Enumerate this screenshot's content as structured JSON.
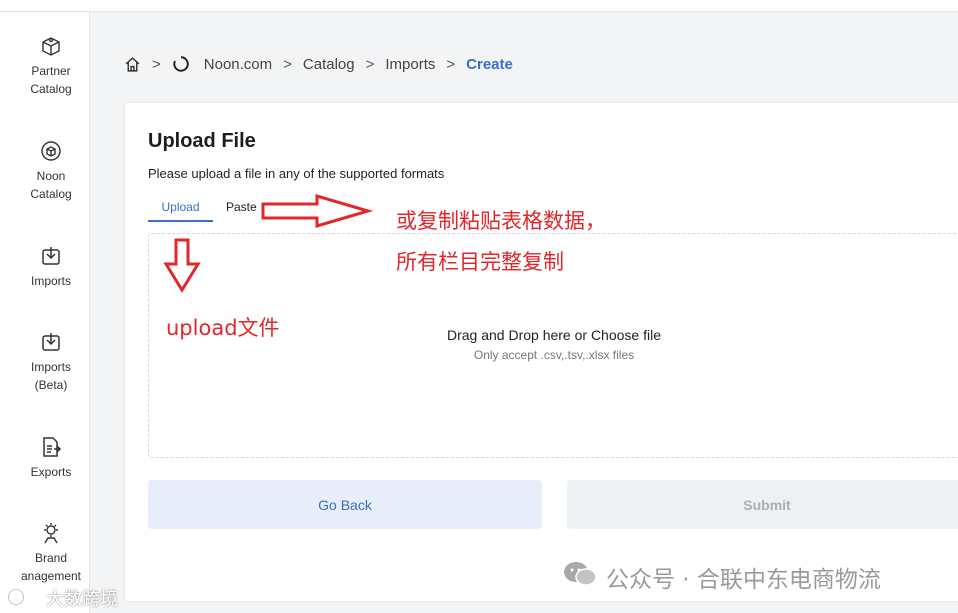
{
  "sidebar": {
    "items": [
      {
        "label": "Partner\nCatalog",
        "icon": "partner-catalog-icon"
      },
      {
        "label": "Noon\nCatalog",
        "icon": "noon-catalog-icon"
      },
      {
        "label": "Imports",
        "icon": "imports-icon"
      },
      {
        "label": "Imports\n(Beta)",
        "icon": "imports-beta-icon"
      },
      {
        "label": "Exports",
        "icon": "exports-icon"
      },
      {
        "label": "Brand\nanagement",
        "icon": "brand-management-icon"
      }
    ]
  },
  "breadcrumb": {
    "home_icon": "home-icon",
    "items": [
      "Noon.com",
      "Catalog",
      "Imports",
      "Create"
    ],
    "current_color": "#3a6fc4"
  },
  "upload": {
    "title": "Upload File",
    "subtitle": "Please upload a file in any of the supported formats",
    "tabs": [
      {
        "label": "Upload",
        "active": true
      },
      {
        "label": "Paste",
        "active": false
      }
    ],
    "dropzone": {
      "main_text": "Drag and Drop here or Choose file",
      "hint": "Only accept .csv,.tsv,.xlsx files"
    }
  },
  "actions": {
    "back_label": "Go Back",
    "submit_label": "Submit"
  },
  "annotations": {
    "paste_note": "或复制粘贴表格数据，所有栏目完整复制",
    "upload_note": "upload文件",
    "color": "#e3262a"
  },
  "watermarks": {
    "right": "公众号 · 合联中东电商物流",
    "left": "大数跨境"
  }
}
